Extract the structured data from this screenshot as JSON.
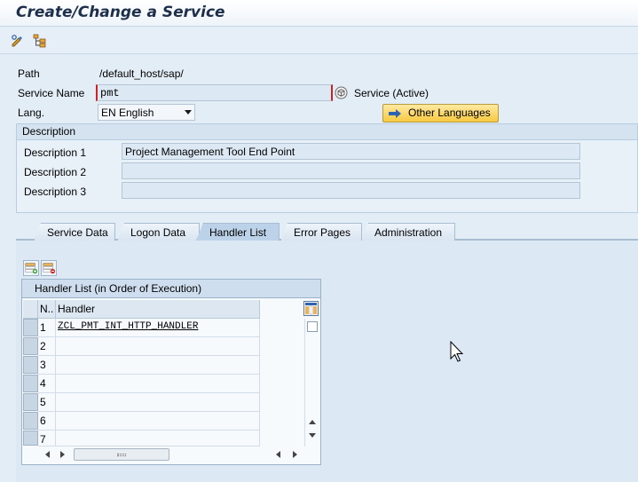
{
  "window": {
    "title": "Create/Change a Service"
  },
  "toolbar": {
    "icons": [
      "display-change-icon",
      "hierarchy-icon"
    ]
  },
  "form": {
    "path_label": "Path",
    "path_value": "/default_host/sap/",
    "service_name_label": "Service Name",
    "service_name_value": "pmt",
    "service_status": "Service (Active)",
    "lang_label": "Lang.",
    "lang_value": "EN English",
    "other_languages_button": "Other Languages"
  },
  "description_group": {
    "header": "Description",
    "rows": [
      {
        "label": "Description 1",
        "value": "Project Management Tool End Point"
      },
      {
        "label": "Description 2",
        "value": ""
      },
      {
        "label": "Description 3",
        "value": ""
      }
    ]
  },
  "tabs": [
    {
      "label": "Service Data",
      "active": false
    },
    {
      "label": "Logon Data",
      "active": false
    },
    {
      "label": "Handler List",
      "active": true
    },
    {
      "label": "Error Pages",
      "active": false
    },
    {
      "label": "Administration",
      "active": false
    }
  ],
  "handler_table": {
    "title": "Handler List (in Order of Execution)",
    "columns": [
      "N..",
      "Handler"
    ],
    "rows": [
      {
        "num": "1",
        "handler": "ZCL_PMT_INT_HTTP_HANDLER"
      },
      {
        "num": "2",
        "handler": ""
      },
      {
        "num": "3",
        "handler": ""
      },
      {
        "num": "4",
        "handler": ""
      },
      {
        "num": "5",
        "handler": ""
      },
      {
        "num": "6",
        "handler": ""
      },
      {
        "num": "7",
        "handler": ""
      }
    ]
  },
  "colors": {
    "accent_button": "#f7c941",
    "required_marker": "#d21e1e",
    "title_text": "#1d2f4a",
    "background": "#dfebf5"
  }
}
